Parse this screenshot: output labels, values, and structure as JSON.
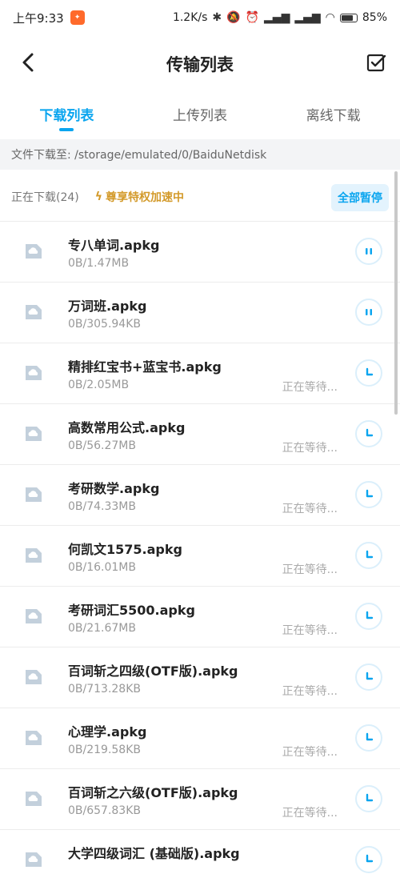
{
  "status_bar": {
    "time": "上午9:33",
    "net_speed": "1.2K/s",
    "battery": "85%",
    "battery_level": 0.85
  },
  "header": {
    "title": "传输列表"
  },
  "tabs": [
    {
      "label": "下载列表",
      "active": true
    },
    {
      "label": "上传列表",
      "active": false
    },
    {
      "label": "离线下载",
      "active": false
    }
  ],
  "path_bar": "文件下载至: /storage/emulated/0/BaiduNetdisk",
  "summary": {
    "count": "正在下载(24)",
    "vip": "尊享特权加速中",
    "pause_all": "全部暂停"
  },
  "colors": {
    "accent": "#0aa5ef",
    "vip": "#d39a2a"
  },
  "files": [
    {
      "name": "专八单词.apkg",
      "size": "0B/1.47MB",
      "status": "",
      "action": "pause"
    },
    {
      "name": "万词班.apkg",
      "size": "0B/305.94KB",
      "status": "",
      "action": "pause"
    },
    {
      "name": "精排红宝书+蓝宝书.apkg",
      "size": "0B/2.05MB",
      "status": "正在等待...",
      "action": "wait"
    },
    {
      "name": "高数常用公式.apkg",
      "size": "0B/56.27MB",
      "status": "正在等待...",
      "action": "wait"
    },
    {
      "name": "考研数学.apkg",
      "size": "0B/74.33MB",
      "status": "正在等待...",
      "action": "wait"
    },
    {
      "name": "何凯文1575.apkg",
      "size": "0B/16.01MB",
      "status": "正在等待...",
      "action": "wait"
    },
    {
      "name": "考研词汇5500.apkg",
      "size": "0B/21.67MB",
      "status": "正在等待...",
      "action": "wait"
    },
    {
      "name": "百词斩之四级(OTF版).apkg",
      "size": "0B/713.28KB",
      "status": "正在等待...",
      "action": "wait"
    },
    {
      "name": "心理学.apkg",
      "size": "0B/219.58KB",
      "status": "正在等待...",
      "action": "wait"
    },
    {
      "name": "百词斩之六级(OTF版).apkg",
      "size": "0B/657.83KB",
      "status": "正在等待...",
      "action": "wait"
    },
    {
      "name": "大学四级词汇 (基础版).apkg",
      "size": "",
      "status": "",
      "action": "wait"
    }
  ]
}
